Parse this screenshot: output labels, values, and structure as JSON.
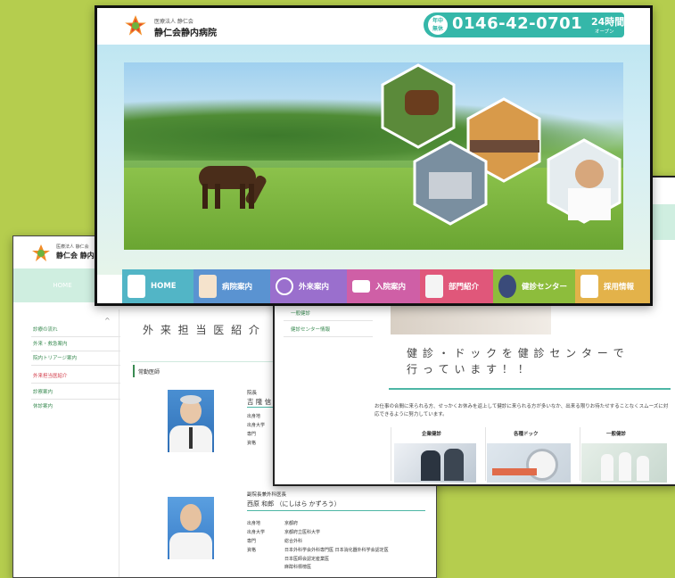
{
  "colors": {
    "background": "#b5cd4e",
    "accent_green": "#3a8b52",
    "phone_teal": "#35b7a9",
    "active_red": "#d23a48"
  },
  "left_window": {
    "org": "医療法人 静仁会",
    "name": "静仁会 静内",
    "home_label": "HOME",
    "sidebar": [
      "診療の流れ",
      "外来・救急案内",
      "院内トリアージ案内",
      "外来担当医紹介",
      "診察案内",
      "休診案内"
    ],
    "active_index": 3,
    "page_title": "外 来 担 当 医 紹 介",
    "section_label": "常勤医師",
    "doctor1": {
      "role": "院長",
      "name": "吉 隆 信",
      "rows": [
        {
          "k": "出身地",
          "v": ""
        },
        {
          "k": "出身大学",
          "v": ""
        },
        {
          "k": "専門",
          "v": ""
        },
        {
          "k": "資格",
          "v": ""
        }
      ]
    },
    "doctor2": {
      "role": "副院長兼外科医長",
      "name": "西原 和郎 （にしはら かずろう）",
      "rows": [
        {
          "k": "出身地",
          "v": "京都府"
        },
        {
          "k": "出身大学",
          "v": "京都府立医科大学"
        },
        {
          "k": "専門",
          "v": "総合外科"
        },
        {
          "k": "資格",
          "v": "日本外科学会外科専門医 日本消化器外科学会認定医"
        }
      ],
      "extra": [
        "日本医師会認定産業医",
        "麻酔科標榜医"
      ]
    }
  },
  "right_window": {
    "sidebar": [
      "一般健診",
      "健診センター情報"
    ],
    "headline1": "健 診 ・ ド ッ ク を 健 診 セ ン タ ー で",
    "headline2": "行 っ て い ま す ！ ！",
    "body": "お仕事の合間に来られる方、せっかくお休みを返上して健診に来られる方が多いなか、出来る限りお待たせすることなくスムーズに対応できるように努力しています。",
    "cards": [
      "企業健診",
      "各種ドック",
      "一般健診"
    ]
  },
  "front_window": {
    "org": "医療法人 静仁会",
    "name": "静仁会静内病院",
    "badge_line1": "年中",
    "badge_line2": "無休",
    "phone": "0146-42-0701",
    "hours_top": "24時間",
    "hours_bottom": "オープン",
    "nav": [
      {
        "label": "HOME",
        "icon": "hospital-icon",
        "color": "#52b5c6"
      },
      {
        "label": "病院案内",
        "icon": "doctor-icon",
        "color": "#5a93d1"
      },
      {
        "label": "外来案内",
        "icon": "stethoscope-icon",
        "color": "#9a6fcd"
      },
      {
        "label": "入院案内",
        "icon": "bed-icon",
        "color": "#cf5fa6"
      },
      {
        "label": "部門紹介",
        "icon": "xray-icon",
        "color": "#e0577a"
      },
      {
        "label": "健診センター",
        "icon": "scanner-icon",
        "color": "#8dbd3c"
      },
      {
        "label": "採用情報",
        "icon": "recruit-icon",
        "color": "#e3b24a"
      }
    ]
  }
}
